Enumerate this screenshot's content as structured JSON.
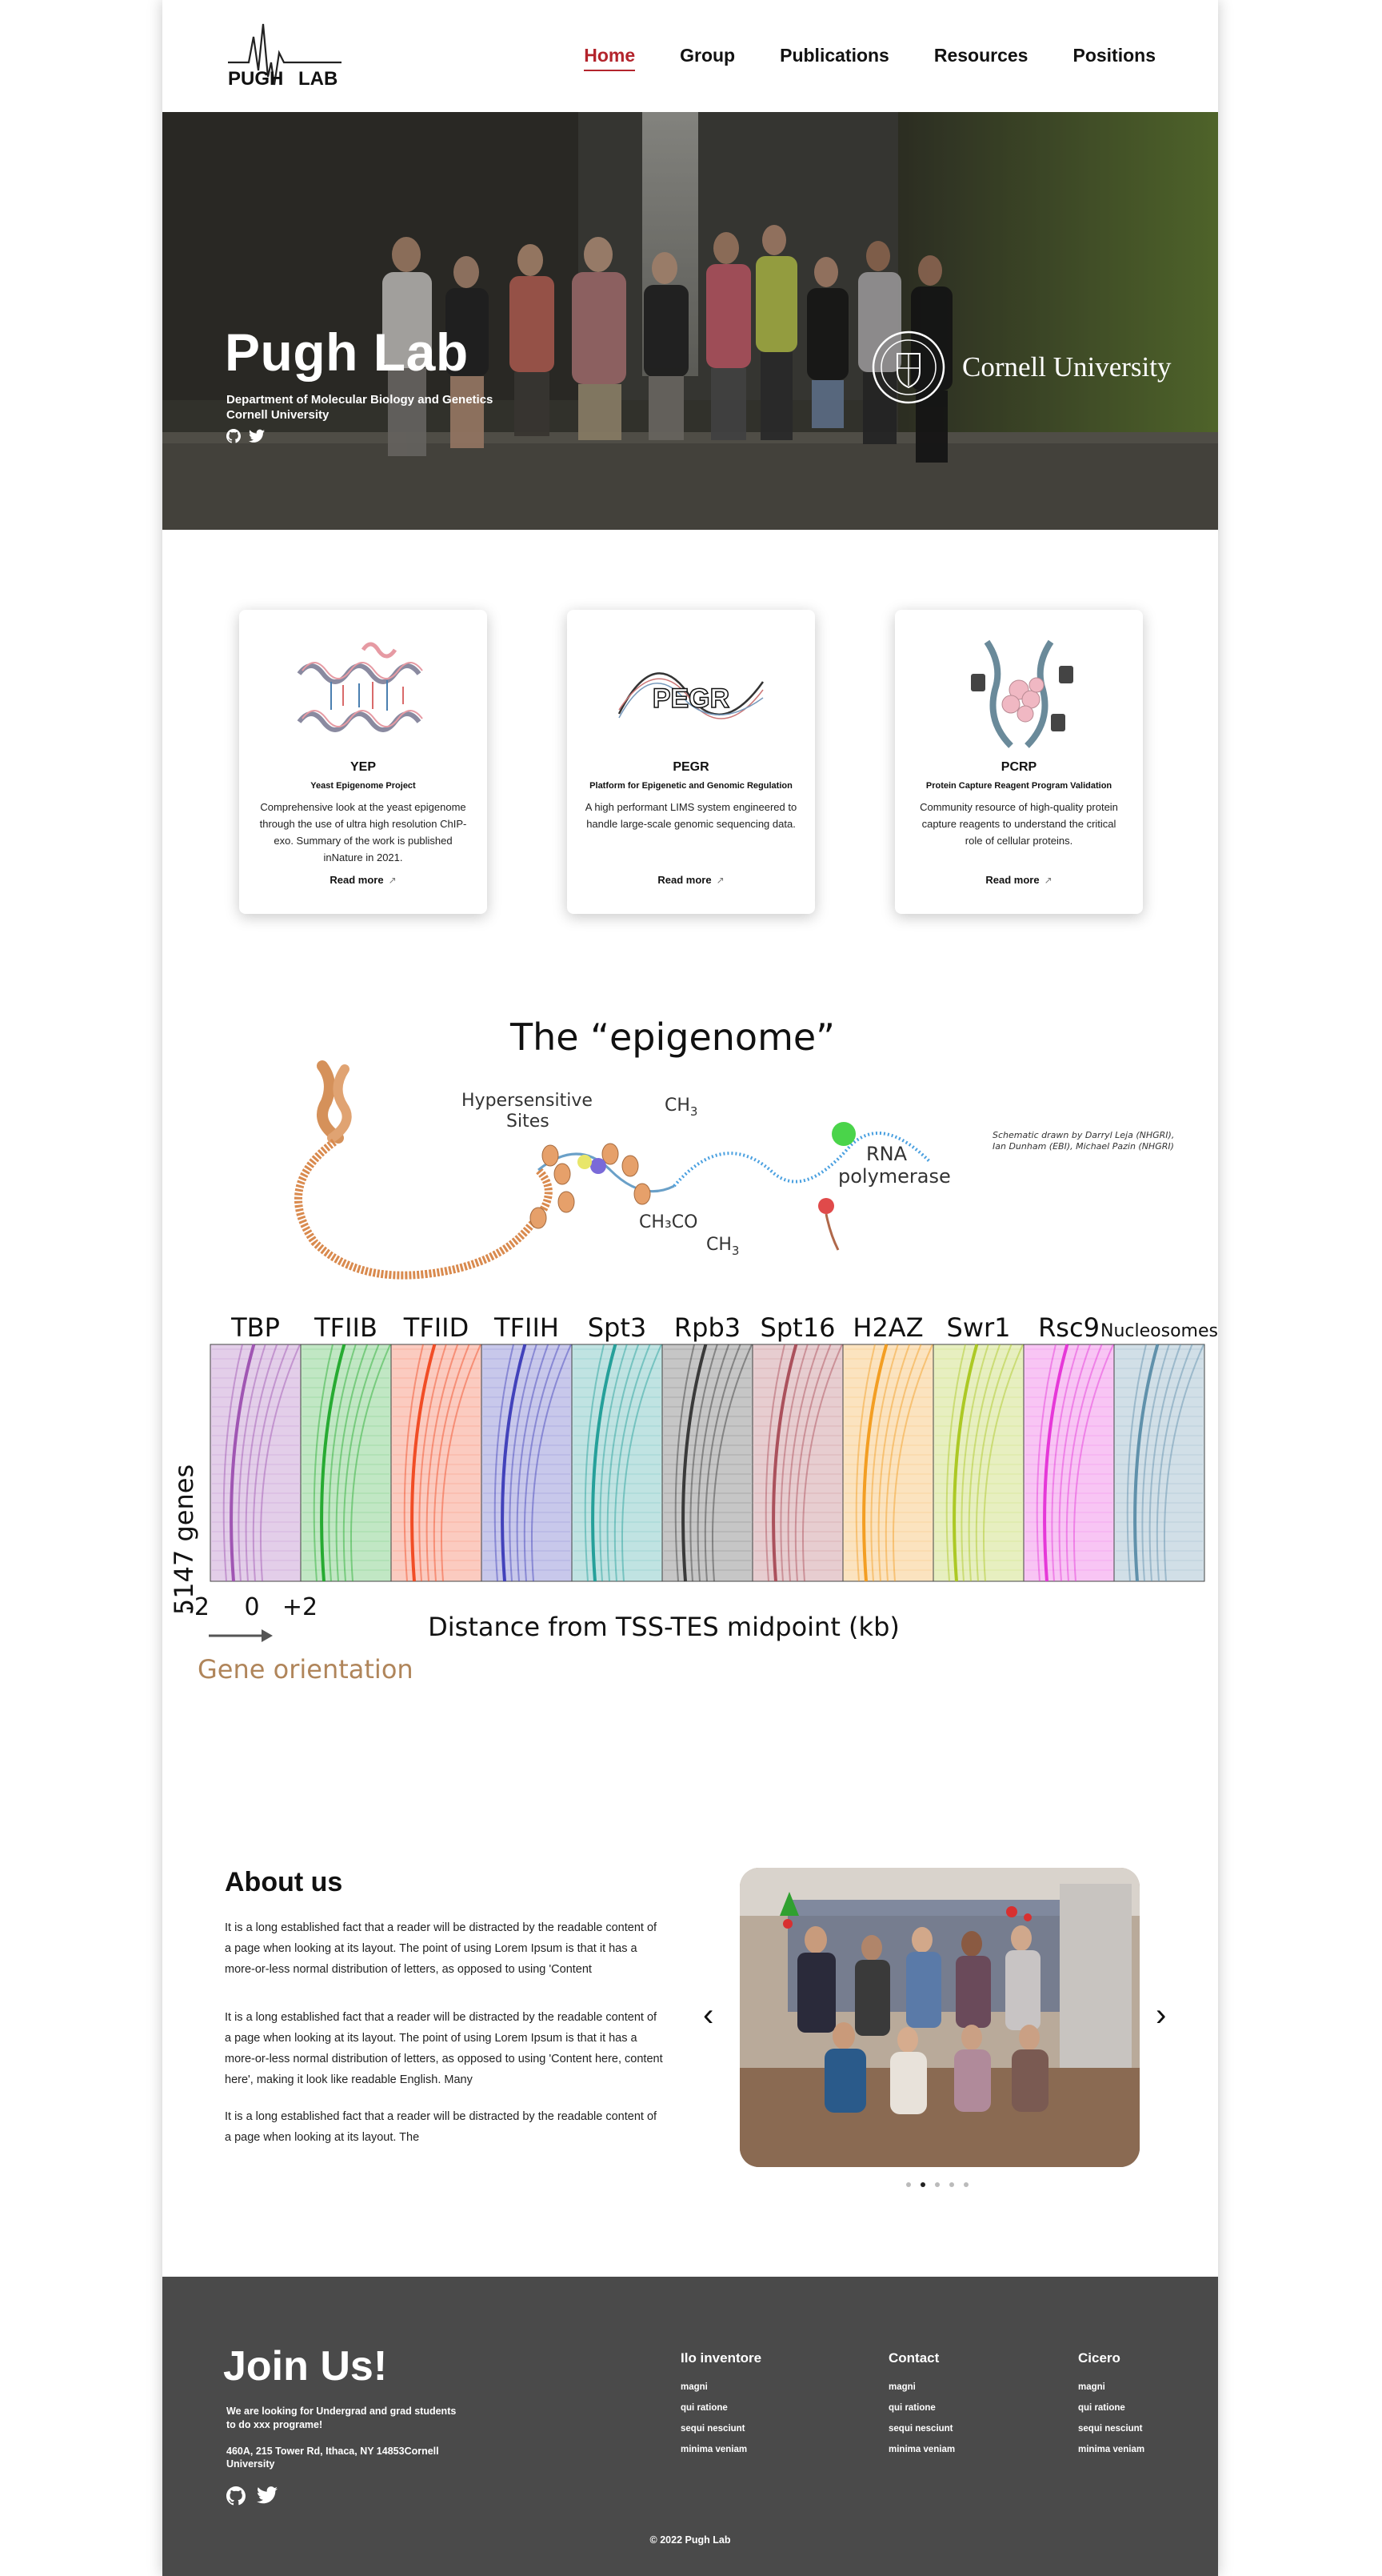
{
  "nav": {
    "logo_text_left": "PUGH",
    "logo_text_right": "LAB",
    "links": [
      {
        "label": "Home",
        "active": true
      },
      {
        "label": "Group",
        "active": false
      },
      {
        "label": "Publications",
        "active": false
      },
      {
        "label": "Resources",
        "active": false
      },
      {
        "label": "Positions",
        "active": false
      }
    ],
    "accent_color": "#b3242c"
  },
  "hero": {
    "title": "Pugh Lab",
    "subtitle_line1": "Department of Molecular Biology and Genetics",
    "subtitle_line2": "Cornell University",
    "partner": "Cornell University",
    "social": [
      "github-icon",
      "twitter-icon"
    ]
  },
  "cards": [
    {
      "title": "YEP",
      "subtitle": "Yeast Epigenome Project",
      "description": "Comprehensive look at the yeast epigenome through the use of ultra high resolution ChIP-exo. Summary of the work is published inNature in 2021.",
      "link": "Read more"
    },
    {
      "title": "PEGR",
      "subtitle": "Platform for Epigenetic and Genomic Regulation",
      "description": "A high performant LIMS system engineered to handle large-scale genomic sequencing data.",
      "link": "Read more",
      "logo_text": "PEGR"
    },
    {
      "title": "PCRP",
      "subtitle": "Protein Capture Reagent Program Validation",
      "description": "Community resource of high-quality protein capture reagents to understand the critical role of cellular proteins.",
      "link": "Read more"
    }
  ],
  "figure": {
    "title": "The “epigenome”",
    "labels": {
      "hypersensitive": "Hypersensitive",
      "sites": "Sites",
      "ch3_top": "CH",
      "ch3co": "CH₃CO",
      "ch3_bottom": "CH",
      "rna": "RNA",
      "polymerase": "polymerase",
      "credit_line1": "Schematic drawn by Darryl Leja (NHGRI),",
      "credit_line2": "Ian Dunham (EBI), Michael Pazin (NHGRI)"
    },
    "heatmap_columns": [
      {
        "name": "TBP",
        "color": "#9c4fb0"
      },
      {
        "name": "TFIIB",
        "color": "#1fa82a"
      },
      {
        "name": "TFIID",
        "color": "#f0461e"
      },
      {
        "name": "TFIIH",
        "color": "#3b3bb8"
      },
      {
        "name": "Spt3",
        "color": "#1d9c96"
      },
      {
        "name": "Rpb3",
        "color": "#333333"
      },
      {
        "name": "Spt16",
        "color": "#a84a55"
      },
      {
        "name": "H2AZ",
        "color": "#f29a1a"
      },
      {
        "name": "Swr1",
        "color": "#a9c61c"
      },
      {
        "name": "Rsc9",
        "color": "#e530d6"
      },
      {
        "name": "Nucleosomes",
        "color": "#5a8ca8"
      }
    ],
    "y_label": "5147 genes",
    "tick_left": "-2",
    "tick_mid": "0",
    "tick_right": "+2",
    "x_label": "Distance from TSS-TES midpoint (kb)",
    "gene_orientation": "Gene orientation"
  },
  "about": {
    "title": "About us",
    "paragraphs": [
      "It is a long established fact that a reader will be distracted by the readable content of a page when looking at its layout. The point of using Lorem Ipsum is that it has a more-or-less normal distribution of letters, as opposed to using 'Content",
      "It is a long established fact that a reader will be distracted by the readable content of a page when looking at its layout. The point of using Lorem Ipsum is that it has a more-or-less normal distribution of letters, as opposed to using 'Content here, content here', making it look like readable English. Many",
      "It is a long established fact that a reader will be distracted by the readable content of a page when looking at its layout. The"
    ],
    "carousel": {
      "prev": "‹",
      "next": "›",
      "slides": 5,
      "active": 1
    }
  },
  "footer": {
    "join_title": "Join Us!",
    "join_desc": "We are looking for Undergrad and grad students to do xxx programe!",
    "address": "460A, 215 Tower Rd, Ithaca, NY 14853Cornell University",
    "columns": [
      {
        "title": "Ilo inventore",
        "items": [
          "magni",
          "qui ratione",
          "sequi nesciunt",
          "minima veniam"
        ]
      },
      {
        "title": "Contact",
        "items": [
          "magni",
          "qui ratione",
          "sequi nesciunt",
          "minima veniam"
        ]
      },
      {
        "title": "Cicero",
        "items": [
          "magni",
          "qui ratione",
          "sequi nesciunt",
          "minima veniam"
        ]
      }
    ],
    "copyright": "© 2022 Pugh Lab",
    "background": "#4a4a4a"
  }
}
